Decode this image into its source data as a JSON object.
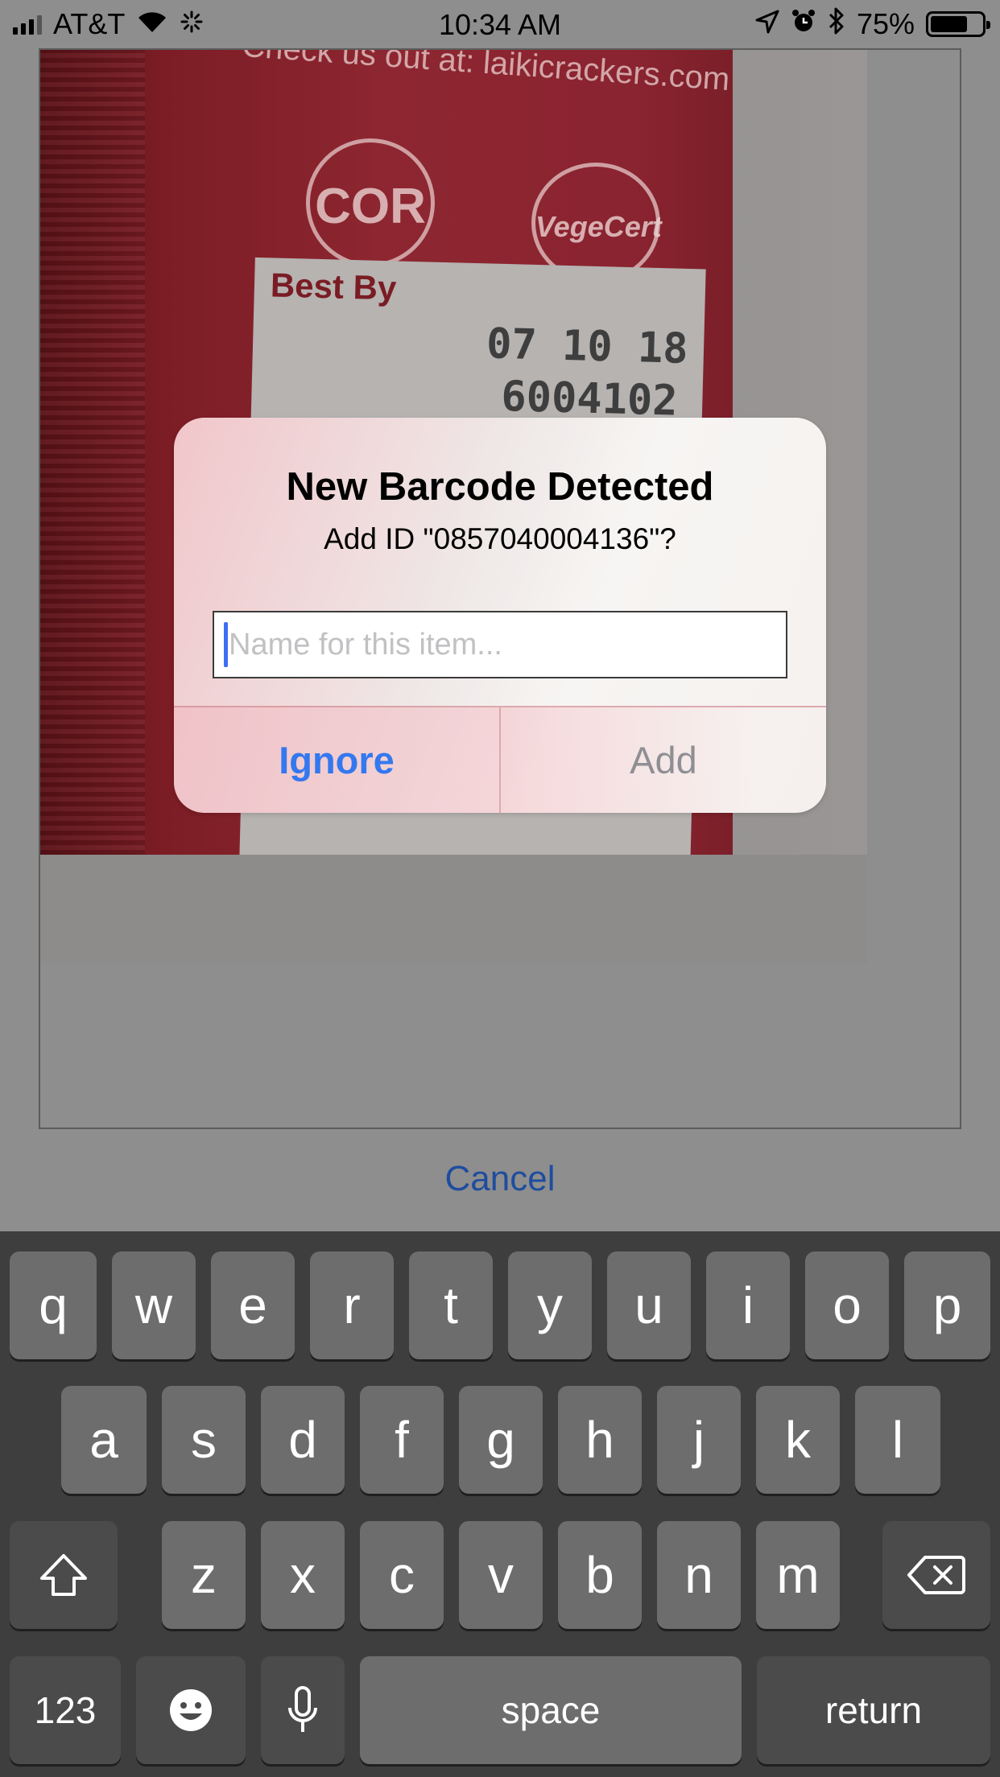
{
  "status_bar": {
    "carrier": "AT&T",
    "time": "10:34 AM",
    "battery_percent": "75%",
    "battery_level": 0.75,
    "icons": [
      "signal-icon",
      "wifi-icon",
      "activity-spinner-icon",
      "location-icon",
      "alarm-icon",
      "bluetooth-icon",
      "battery-icon"
    ]
  },
  "camera_preview": {
    "package_url": "Check us out at: laikicrackers.com",
    "cert_cor": "COR",
    "cert_vegan": "VegeCert",
    "best_by_label": "Best By",
    "best_by_date": "07 10 18",
    "lot_code": "6004102"
  },
  "alert": {
    "title": "New Barcode Detected",
    "message": "Add ID \"0857040004136\"?",
    "input_placeholder": "Name for this item...",
    "input_value": "",
    "ignore_label": "Ignore",
    "add_label": "Add"
  },
  "cancel_label": "Cancel",
  "keyboard": {
    "row1": [
      "q",
      "w",
      "e",
      "r",
      "t",
      "y",
      "u",
      "i",
      "o",
      "p"
    ],
    "row2": [
      "a",
      "s",
      "d",
      "f",
      "g",
      "h",
      "j",
      "k",
      "l"
    ],
    "row3": [
      "z",
      "x",
      "c",
      "v",
      "b",
      "n",
      "m"
    ],
    "numbers_label": "123",
    "space_label": "space",
    "return_label": "return"
  },
  "colors": {
    "accent_blue": "#3478f0",
    "cancel_blue": "#1f4d9e",
    "caret_blue": "#3d6ff5",
    "keyboard_bg": "#3e3e3e",
    "key_bg": "#6d6d6d"
  }
}
